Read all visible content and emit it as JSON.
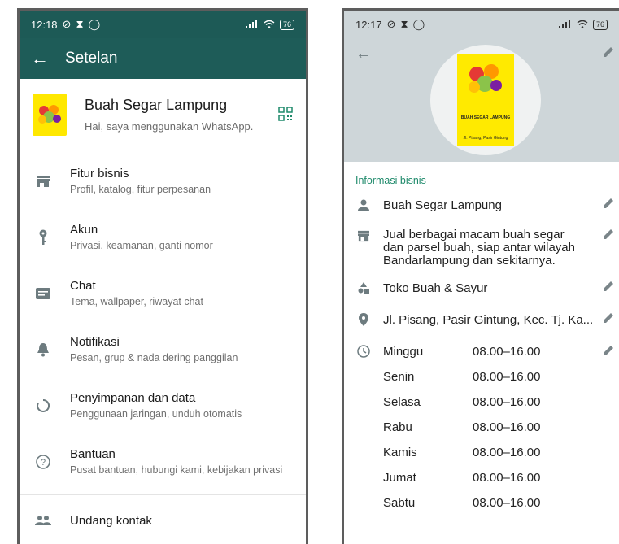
{
  "left": {
    "status": {
      "time": "12:18",
      "battery": "76"
    },
    "toolbar": {
      "title": "Setelan"
    },
    "profile": {
      "name": "Buah Segar Lampung",
      "status": "Hai, saya menggunakan WhatsApp."
    },
    "menu": [
      {
        "title": "Fitur bisnis",
        "subtitle": "Profil, katalog, fitur perpesanan",
        "icon": "store-icon"
      },
      {
        "title": "Akun",
        "subtitle": "Privasi, keamanan, ganti nomor",
        "icon": "key-icon"
      },
      {
        "title": "Chat",
        "subtitle": "Tema, wallpaper, riwayat chat",
        "icon": "chat-icon"
      },
      {
        "title": "Notifikasi",
        "subtitle": "Pesan, grup & nada dering panggilan",
        "icon": "bell-icon"
      },
      {
        "title": "Penyimpanan dan data",
        "subtitle": "Penggunaan jaringan, unduh otomatis",
        "icon": "storage-icon"
      },
      {
        "title": "Bantuan",
        "subtitle": "Pusat bantuan, hubungi kami, kebijakan privasi",
        "icon": "help-icon"
      }
    ],
    "invite": {
      "title": "Undang kontak",
      "icon": "people-icon"
    }
  },
  "right": {
    "status": {
      "time": "12:17",
      "battery": "76"
    },
    "logo_text": {
      "line1": "BUAH SEGAR LAMPUNG",
      "line2": "Jl. Pisang, Pasir Gintung"
    },
    "section_label": "Informasi bisnis",
    "name": "Buah Segar Lampung",
    "description": "Jual berbagai macam buah segar dan parsel buah, siap antar wilayah Bandarlampung dan sekitarnya.",
    "category": "Toko Buah & Sayur",
    "address": "Jl. Pisang, Pasir Gintung, Kec. Tj. Ka...",
    "hours": [
      {
        "day": "Minggu",
        "time": "08.00–16.00"
      },
      {
        "day": "Senin",
        "time": "08.00–16.00"
      },
      {
        "day": "Selasa",
        "time": "08.00–16.00"
      },
      {
        "day": "Rabu",
        "time": "08.00–16.00"
      },
      {
        "day": "Kamis",
        "time": "08.00–16.00"
      },
      {
        "day": "Jumat",
        "time": "08.00–16.00"
      },
      {
        "day": "Sabtu",
        "time": "08.00–16.00"
      }
    ]
  },
  "colors": {
    "toolbar": "#1e5c58",
    "accent": "#1f8a6b",
    "header_right": "#ced6d9",
    "logo_bg": "#ffea00"
  }
}
